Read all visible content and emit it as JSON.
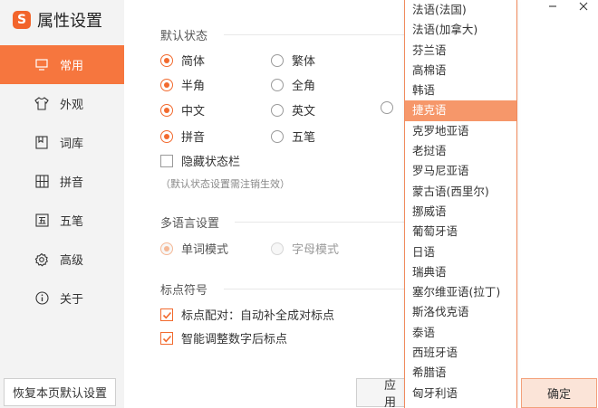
{
  "app": {
    "title": "属性设置",
    "logo_letter": "S"
  },
  "sidebar": {
    "items": [
      {
        "label": "常用",
        "icon": "monitor-icon",
        "active": true
      },
      {
        "label": "外观",
        "icon": "shirt-icon",
        "active": false
      },
      {
        "label": "词库",
        "icon": "book-icon",
        "active": false
      },
      {
        "label": "拼音",
        "icon": "grid-icon",
        "active": false
      },
      {
        "label": "五笔",
        "icon": "wubi-icon",
        "active": false
      },
      {
        "label": "高级",
        "icon": "gear-icon",
        "active": false
      },
      {
        "label": "关于",
        "icon": "info-icon",
        "active": false
      }
    ],
    "reset_label": "恢复本页默认设置"
  },
  "default_state": {
    "title": "默认状态",
    "rows": [
      {
        "left": "简体",
        "left_on": true,
        "right": "繁体",
        "right_on": false
      },
      {
        "left": "半角",
        "left_on": true,
        "right": "全角",
        "right_on": false
      },
      {
        "left": "中文",
        "left_on": true,
        "right": "英文",
        "right_on": false
      },
      {
        "left": "拼音",
        "left_on": true,
        "right": "五笔",
        "right_on": false
      }
    ],
    "hide_status_bar": "隐藏状态栏",
    "note": "（默认状态设置需注销生效）"
  },
  "multilang": {
    "title": "多语言设置",
    "word_mode": "单词模式",
    "letter_mode": "字母模式"
  },
  "punct": {
    "title": "标点符号",
    "pair": "标点配对：自动补全成对标点",
    "smart": "智能调整数字后标点"
  },
  "language_list": {
    "items": [
      "法语(法国)",
      "法语(加拿大)",
      "芬兰语",
      "高棉语",
      "韩语",
      "捷克语",
      "克罗地亚语",
      "老挝语",
      "罗马尼亚语",
      "蒙古语(西里尔)",
      "挪威语",
      "葡萄牙语",
      "日语",
      "瑞典语",
      "塞尔维亚语(拉丁)",
      "斯洛伐克语",
      "泰语",
      "西班牙语",
      "希腊语",
      "匈牙利语"
    ],
    "selected_index": 5
  },
  "buttons": {
    "apply": "应用",
    "ok": "确定"
  },
  "colors": {
    "accent": "#f6763e",
    "selected_item": "#f6976a"
  }
}
